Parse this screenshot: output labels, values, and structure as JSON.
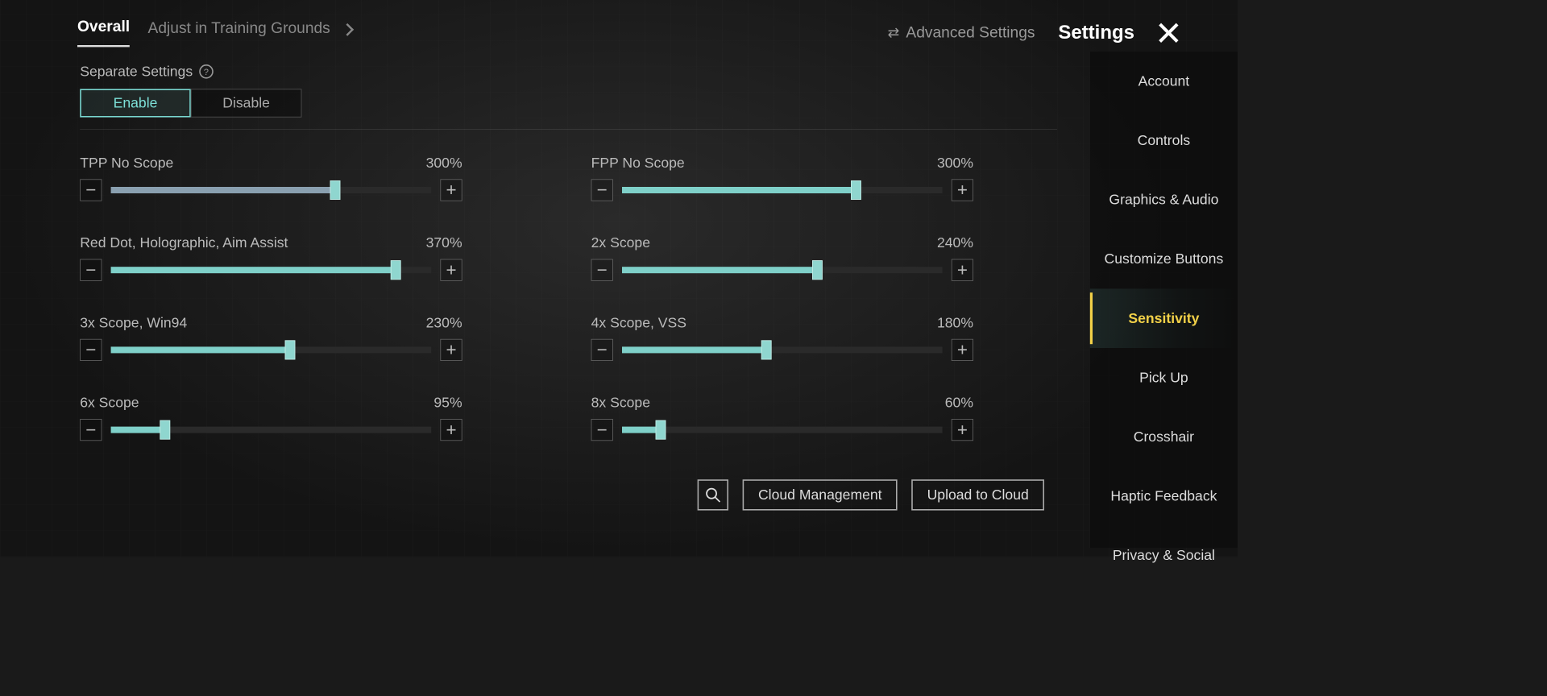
{
  "header": {
    "tab_overall": "Overall",
    "tab_training": "Adjust in Training Grounds",
    "advanced": "Advanced Settings",
    "settings_title": "Settings"
  },
  "separate": {
    "label": "Separate Settings",
    "enable": "Enable",
    "disable": "Disable"
  },
  "sliders": [
    {
      "label": "TPP No Scope",
      "value_text": "300%",
      "pct": 70,
      "muted": true
    },
    {
      "label": "FPP No Scope",
      "value_text": "300%",
      "pct": 73
    },
    {
      "label": "Red Dot, Holographic, Aim Assist",
      "value_text": "370%",
      "pct": 89
    },
    {
      "label": "2x Scope",
      "value_text": "240%",
      "pct": 61
    },
    {
      "label": "3x Scope, Win94",
      "value_text": "230%",
      "pct": 56
    },
    {
      "label": "4x Scope, VSS",
      "value_text": "180%",
      "pct": 45
    },
    {
      "label": "6x Scope",
      "value_text": "95%",
      "pct": 17
    },
    {
      "label": "8x Scope",
      "value_text": "60%",
      "pct": 12
    }
  ],
  "actions": {
    "cloud_management": "Cloud Management",
    "upload_cloud": "Upload to Cloud"
  },
  "sidebar": {
    "items": [
      {
        "label": "Account"
      },
      {
        "label": "Controls"
      },
      {
        "label": "Graphics & Audio"
      },
      {
        "label": "Customize Buttons"
      },
      {
        "label": "Sensitivity",
        "active": true
      },
      {
        "label": "Pick Up"
      },
      {
        "label": "Crosshair"
      },
      {
        "label": "Haptic Feedback"
      },
      {
        "label": "Privacy & Social"
      }
    ]
  }
}
